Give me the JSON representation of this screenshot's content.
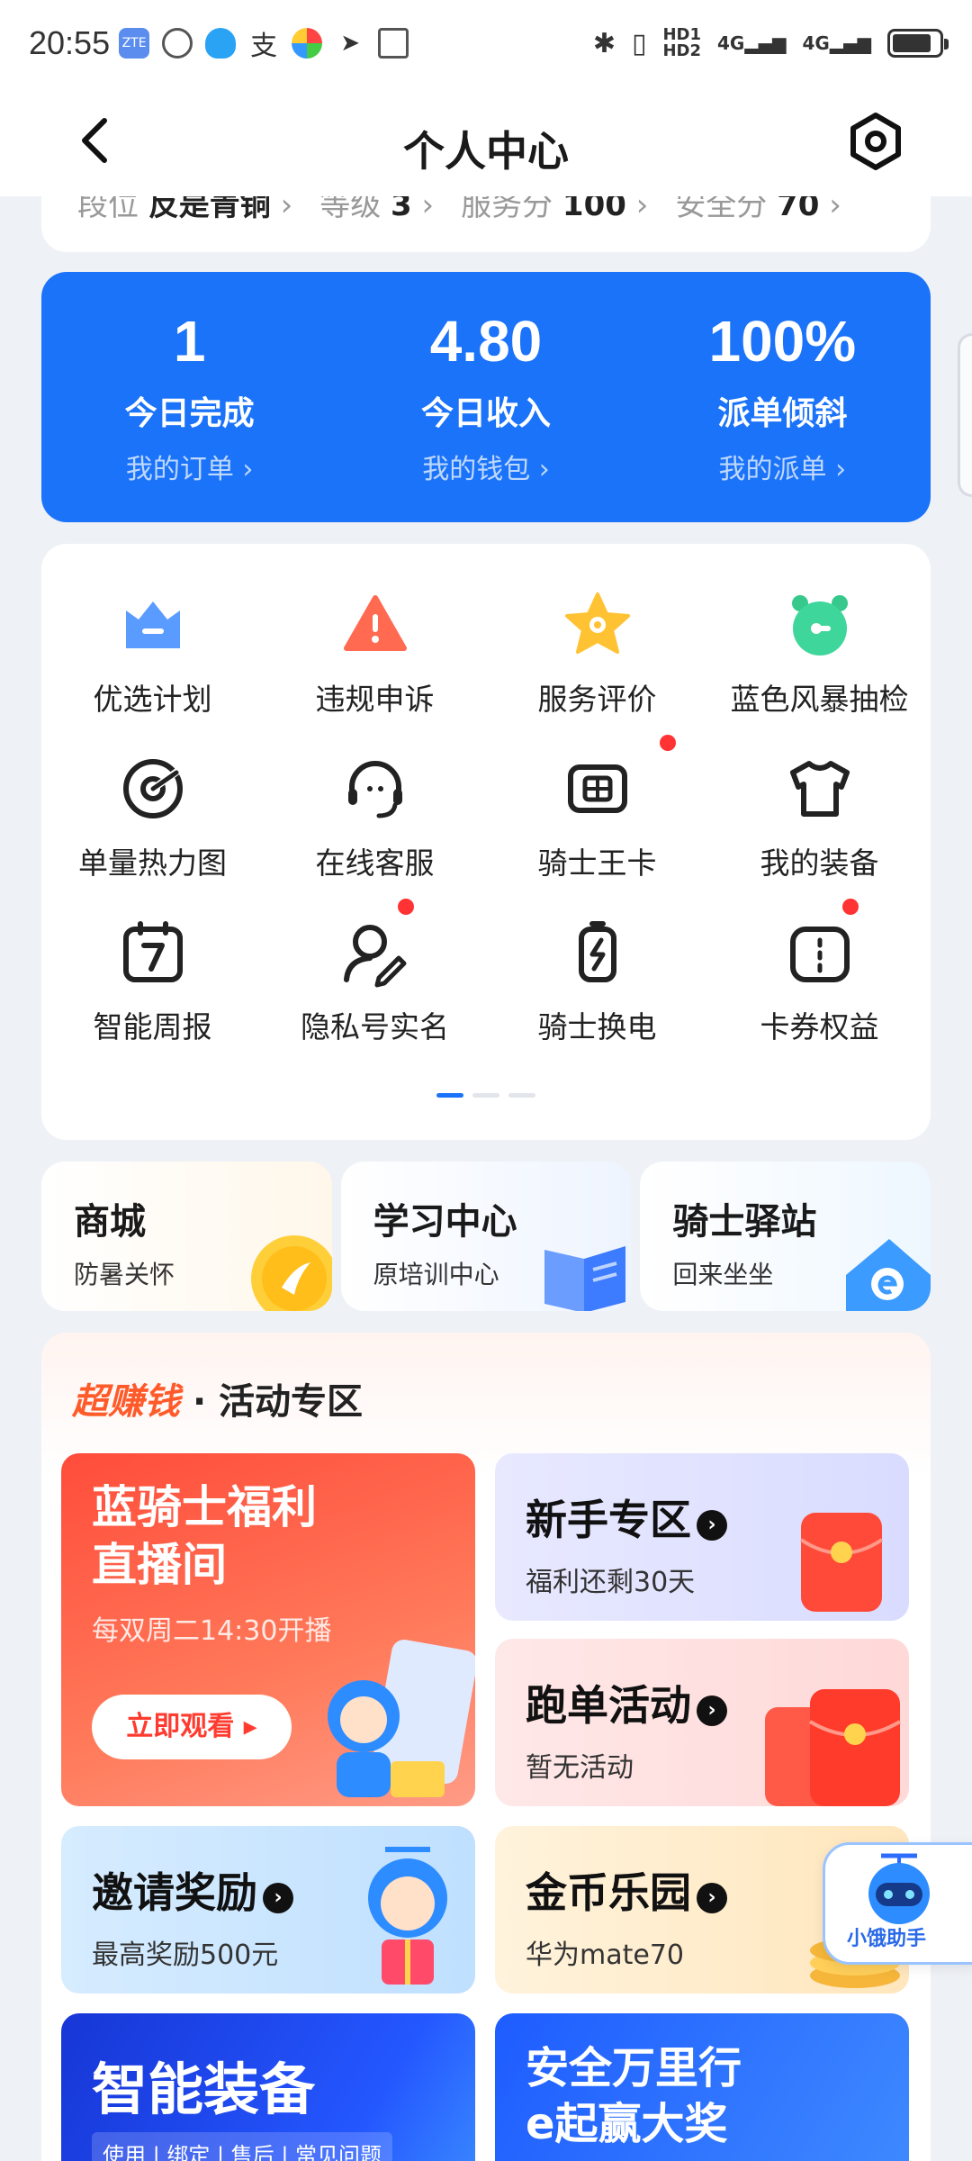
{
  "status_bar": {
    "time": "20:55",
    "network": "4G",
    "hd1": "HD1",
    "hd2": "HD2"
  },
  "header": {
    "title": "个人中心",
    "back_icon": "chevron-left-icon",
    "settings_icon": "gear-hexagon-icon"
  },
  "level_row": {
    "rank_label": "段位",
    "rank_value": "反是青铜",
    "level_label": "等级",
    "level_value": "3",
    "service_label": "服务分",
    "service_value": "100",
    "safety_label": "安全分",
    "safety_value": "70"
  },
  "stats": [
    {
      "value": "1",
      "label": "今日完成",
      "link": "我的订单 ›"
    },
    {
      "value": "4.80",
      "label": "今日收入",
      "link": "我的钱包 ›"
    },
    {
      "value": "100%",
      "label": "派单倾斜",
      "link": "我的派单 ›"
    }
  ],
  "grid": [
    {
      "label": "优选计划",
      "icon": "crown-icon"
    },
    {
      "label": "违规申诉",
      "icon": "warning-triangle-icon"
    },
    {
      "label": "服务评价",
      "icon": "star-icon"
    },
    {
      "label": "蓝色风暴抽检",
      "icon": "alarm-clock-icon"
    },
    {
      "label": "单量热力图",
      "icon": "target-icon"
    },
    {
      "label": "在线客服",
      "icon": "headset-icon"
    },
    {
      "label": "骑士王卡",
      "icon": "sim-card-icon"
    },
    {
      "label": "我的装备",
      "icon": "tshirt-icon"
    },
    {
      "label": "智能周报",
      "icon": "calendar-7-icon"
    },
    {
      "label": "隐私号实名",
      "icon": "user-edit-icon"
    },
    {
      "label": "骑士换电",
      "icon": "battery-swap-icon"
    },
    {
      "label": "卡券权益",
      "icon": "coupon-icon"
    }
  ],
  "quick": [
    {
      "title": "商城",
      "sub": "防暑关怀"
    },
    {
      "title": "学习中心",
      "sub": "原培训中心"
    },
    {
      "title": "骑士驿站",
      "sub": "回来坐坐"
    }
  ],
  "activity": {
    "hot": "超赚钱",
    "title": "· 活动专区",
    "live": {
      "title_line1": "蓝骑士福利",
      "title_line2": "直播间",
      "sub": "每双周二14:30开播",
      "button": "立即观看"
    },
    "newbie": {
      "title": "新手专区",
      "sub": "福利还剩30天"
    },
    "run": {
      "title": "跑单活动",
      "sub": "暂无活动"
    },
    "invite": {
      "title": "邀请奖励",
      "sub": "最高奖励500元"
    },
    "coin": {
      "title": "金币乐园",
      "sub": "华为mate70"
    },
    "smart": {
      "title": "智能装备",
      "sub": "使用 | 绑定 | 售后 | 常见问题"
    },
    "safe": {
      "title_line1": "安全万里行",
      "title_line2": "e起赢大奖"
    }
  },
  "assistant": {
    "label": "小饿助手"
  },
  "colors": {
    "brand_blue": "#1a73f9",
    "red_dot": "#ff3333",
    "hot_orange": "#ff5a2a"
  }
}
